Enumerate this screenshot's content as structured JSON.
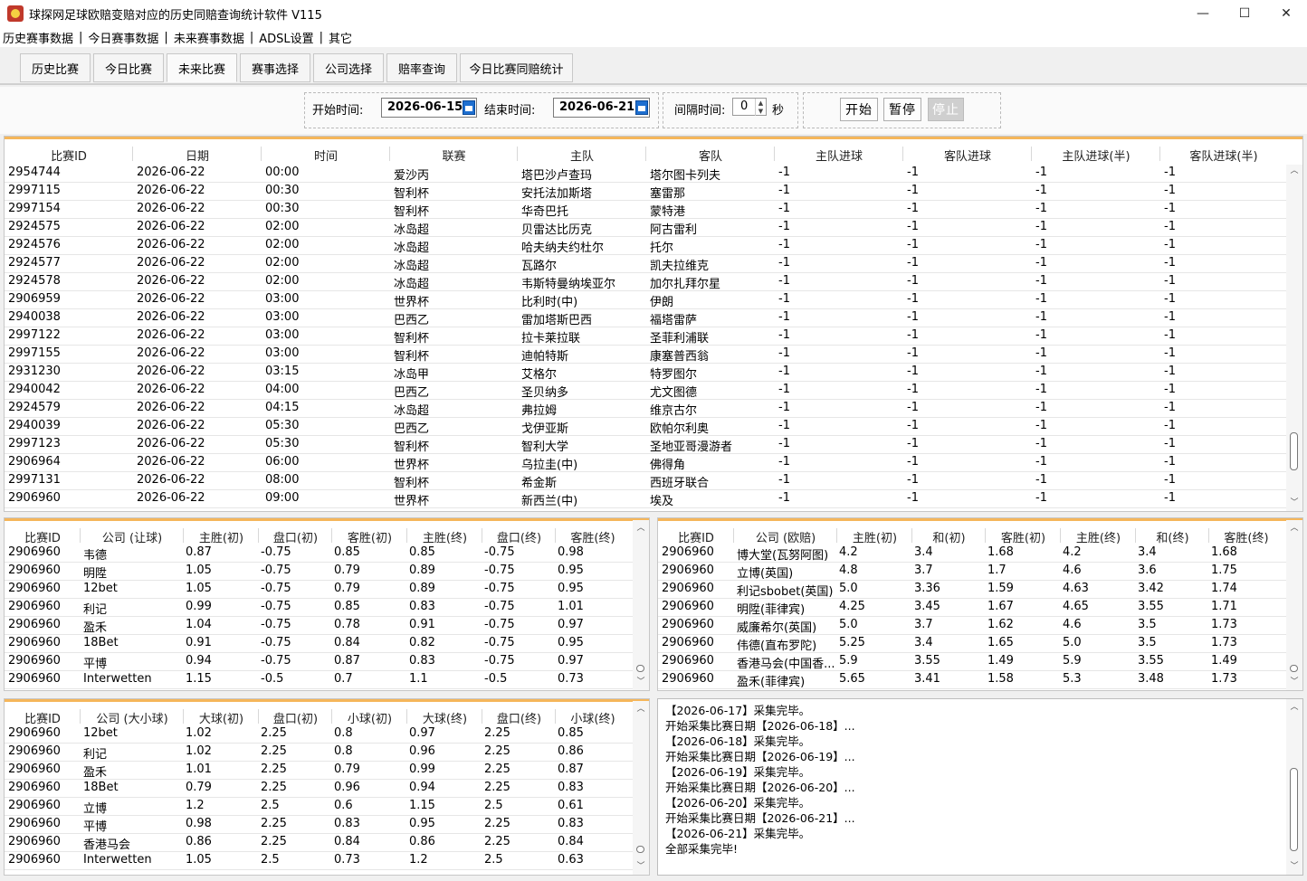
{
  "window": {
    "title": "球探网足球欧赔变赔对应的历史同赔查询统计软件 V115",
    "minimize": "—",
    "maximize": "☐",
    "close": "✕"
  },
  "menu": {
    "items": [
      "历史赛事数据",
      "今日赛事数据",
      "未来赛事数据",
      "ADSL设置",
      "其它"
    ],
    "separator": "|"
  },
  "tabs": [
    "历史比赛",
    "今日比赛",
    "未来比赛",
    "赛事选择",
    "公司选择",
    "赔率查询",
    "今日比赛同赔统计"
  ],
  "active_tab": "未来比赛",
  "filter": {
    "start_label": "开始时间:",
    "start_value": "2026-06-15",
    "end_label": "结束时间:",
    "end_value": "2026-06-21",
    "interval_label": "间隔时间:",
    "interval_value": "0",
    "interval_unit": "秒",
    "start_btn": "开始",
    "pause_btn": "暂停",
    "stop_btn": "停止"
  },
  "matches": {
    "columns": [
      "比赛ID",
      "日期",
      "时间",
      "联赛",
      "主队",
      "客队",
      "主队进球",
      "客队进球",
      "主队进球(半)",
      "客队进球(半)"
    ],
    "rows": [
      [
        "2954744",
        "2026-06-22",
        "00:00",
        "爱沙丙",
        "塔巴沙卢查玛",
        "塔尔图卡列夫",
        "-1",
        "-1",
        "-1",
        "-1"
      ],
      [
        "2997115",
        "2026-06-22",
        "00:30",
        "智利杯",
        "安托法加斯塔",
        "塞雷那",
        "-1",
        "-1",
        "-1",
        "-1"
      ],
      [
        "2997154",
        "2026-06-22",
        "00:30",
        "智利杯",
        "华奇巴托",
        "蒙特港",
        "-1",
        "-1",
        "-1",
        "-1"
      ],
      [
        "2924575",
        "2026-06-22",
        "02:00",
        "冰岛超",
        "贝雷达比历克",
        "阿古雷利",
        "-1",
        "-1",
        "-1",
        "-1"
      ],
      [
        "2924576",
        "2026-06-22",
        "02:00",
        "冰岛超",
        "哈夫纳夫约杜尔",
        "托尔",
        "-1",
        "-1",
        "-1",
        "-1"
      ],
      [
        "2924577",
        "2026-06-22",
        "02:00",
        "冰岛超",
        "瓦路尔",
        "凯夫拉维克",
        "-1",
        "-1",
        "-1",
        "-1"
      ],
      [
        "2924578",
        "2026-06-22",
        "02:00",
        "冰岛超",
        "韦斯特曼纳埃亚尔",
        "加尔扎拜尔星",
        "-1",
        "-1",
        "-1",
        "-1"
      ],
      [
        "2906959",
        "2026-06-22",
        "03:00",
        "世界杯",
        "比利时(中)",
        "伊朗",
        "-1",
        "-1",
        "-1",
        "-1"
      ],
      [
        "2940038",
        "2026-06-22",
        "03:00",
        "巴西乙",
        "雷加塔斯巴西",
        "福塔雷萨",
        "-1",
        "-1",
        "-1",
        "-1"
      ],
      [
        "2997122",
        "2026-06-22",
        "03:00",
        "智利杯",
        "拉卡莱拉联",
        "圣菲利浦联",
        "-1",
        "-1",
        "-1",
        "-1"
      ],
      [
        "2997155",
        "2026-06-22",
        "03:00",
        "智利杯",
        "迪帕特斯",
        "康塞普西翁",
        "-1",
        "-1",
        "-1",
        "-1"
      ],
      [
        "2931230",
        "2026-06-22",
        "03:15",
        "冰岛甲",
        "艾格尔",
        "特罗图尔",
        "-1",
        "-1",
        "-1",
        "-1"
      ],
      [
        "2940042",
        "2026-06-22",
        "04:00",
        "巴西乙",
        "圣贝纳多",
        "尤文图德",
        "-1",
        "-1",
        "-1",
        "-1"
      ],
      [
        "2924579",
        "2026-06-22",
        "04:15",
        "冰岛超",
        "弗拉姆",
        "维京古尔",
        "-1",
        "-1",
        "-1",
        "-1"
      ],
      [
        "2940039",
        "2026-06-22",
        "05:30",
        "巴西乙",
        "戈伊亚斯",
        "欧帕尔利奥",
        "-1",
        "-1",
        "-1",
        "-1"
      ],
      [
        "2997123",
        "2026-06-22",
        "05:30",
        "智利杯",
        "智利大学",
        "圣地亚哥漫游者",
        "-1",
        "-1",
        "-1",
        "-1"
      ],
      [
        "2906964",
        "2026-06-22",
        "06:00",
        "世界杯",
        "乌拉圭(中)",
        "佛得角",
        "-1",
        "-1",
        "-1",
        "-1"
      ],
      [
        "2997131",
        "2026-06-22",
        "08:00",
        "智利杯",
        "希金斯",
        "西班牙联合",
        "-1",
        "-1",
        "-1",
        "-1"
      ],
      [
        "2906960",
        "2026-06-22",
        "09:00",
        "世界杯",
        "新西兰(中)",
        "埃及",
        "-1",
        "-1",
        "-1",
        "-1"
      ]
    ]
  },
  "handicap": {
    "columns": [
      "比赛ID",
      "公司 (让球)",
      "主胜(初)",
      "盘口(初)",
      "客胜(初)",
      "主胜(终)",
      "盘口(终)",
      "客胜(终)"
    ],
    "rows": [
      [
        "2906960",
        "韦德",
        "0.87",
        "-0.75",
        "0.85",
        "0.85",
        "-0.75",
        "0.98"
      ],
      [
        "2906960",
        "明陞",
        "1.05",
        "-0.75",
        "0.79",
        "0.89",
        "-0.75",
        "0.95"
      ],
      [
        "2906960",
        "12bet",
        "1.05",
        "-0.75",
        "0.79",
        "0.89",
        "-0.75",
        "0.95"
      ],
      [
        "2906960",
        "利记",
        "0.99",
        "-0.75",
        "0.85",
        "0.83",
        "-0.75",
        "1.01"
      ],
      [
        "2906960",
        "盈禾",
        "1.04",
        "-0.75",
        "0.78",
        "0.91",
        "-0.75",
        "0.97"
      ],
      [
        "2906960",
        "18Bet",
        "0.91",
        "-0.75",
        "0.84",
        "0.82",
        "-0.75",
        "0.95"
      ],
      [
        "2906960",
        "平博",
        "0.94",
        "-0.75",
        "0.87",
        "0.83",
        "-0.75",
        "0.97"
      ],
      [
        "2906960",
        "Interwetten",
        "1.15",
        "-0.5",
        "0.7",
        "1.1",
        "-0.5",
        "0.73"
      ]
    ]
  },
  "europe": {
    "columns": [
      "比赛ID",
      "公司 (欧赔)",
      "主胜(初)",
      "和(初)",
      "客胜(初)",
      "主胜(终)",
      "和(终)",
      "客胜(终)"
    ],
    "rows": [
      [
        "2906960",
        "博大堂(瓦努阿图)",
        "4.2",
        "3.4",
        "1.68",
        "4.2",
        "3.4",
        "1.68"
      ],
      [
        "2906960",
        "立博(英国)",
        "4.8",
        "3.7",
        "1.7",
        "4.6",
        "3.6",
        "1.75"
      ],
      [
        "2906960",
        "利记sbobet(英国)",
        "5.0",
        "3.36",
        "1.59",
        "4.63",
        "3.42",
        "1.74"
      ],
      [
        "2906960",
        "明陞(菲律宾)",
        "4.25",
        "3.45",
        "1.67",
        "4.65",
        "3.55",
        "1.71"
      ],
      [
        "2906960",
        "威廉希尔(英国)",
        "5.0",
        "3.7",
        "1.62",
        "4.6",
        "3.5",
        "1.73"
      ],
      [
        "2906960",
        "伟德(直布罗陀)",
        "5.25",
        "3.4",
        "1.65",
        "5.0",
        "3.5",
        "1.73"
      ],
      [
        "2906960",
        "香港马会(中国香...",
        "5.9",
        "3.55",
        "1.49",
        "5.9",
        "3.55",
        "1.49"
      ],
      [
        "2906960",
        "盈禾(菲律宾)",
        "5.65",
        "3.41",
        "1.58",
        "5.3",
        "3.48",
        "1.73"
      ]
    ]
  },
  "overunder": {
    "columns": [
      "比赛ID",
      "公司 (大小球)",
      "大球(初)",
      "盘口(初)",
      "小球(初)",
      "大球(终)",
      "盘口(终)",
      "小球(终)"
    ],
    "rows": [
      [
        "2906960",
        "12bet",
        "1.02",
        "2.25",
        "0.8",
        "0.97",
        "2.25",
        "0.85"
      ],
      [
        "2906960",
        "利记",
        "1.02",
        "2.25",
        "0.8",
        "0.96",
        "2.25",
        "0.86"
      ],
      [
        "2906960",
        "盈禾",
        "1.01",
        "2.25",
        "0.79",
        "0.99",
        "2.25",
        "0.87"
      ],
      [
        "2906960",
        "18Bet",
        "0.79",
        "2.25",
        "0.96",
        "0.94",
        "2.25",
        "0.83"
      ],
      [
        "2906960",
        "立博",
        "1.2",
        "2.5",
        "0.6",
        "1.15",
        "2.5",
        "0.61"
      ],
      [
        "2906960",
        "平博",
        "0.98",
        "2.25",
        "0.83",
        "0.95",
        "2.25",
        "0.83"
      ],
      [
        "2906960",
        "香港马会",
        "0.86",
        "2.25",
        "0.84",
        "0.86",
        "2.25",
        "0.84"
      ],
      [
        "2906960",
        "Interwetten",
        "1.05",
        "2.5",
        "0.73",
        "1.2",
        "2.5",
        "0.63"
      ]
    ]
  },
  "log": [
    "【2026-06-17】采集完毕。",
    "开始采集比赛日期【2026-06-18】...",
    "【2026-06-18】采集完毕。",
    "开始采集比赛日期【2026-06-19】...",
    "【2026-06-19】采集完毕。",
    "开始采集比赛日期【2026-06-20】...",
    "【2026-06-20】采集完毕。",
    "开始采集比赛日期【2026-06-21】...",
    "【2026-06-21】采集完毕。",
    "全部采集完毕!"
  ]
}
